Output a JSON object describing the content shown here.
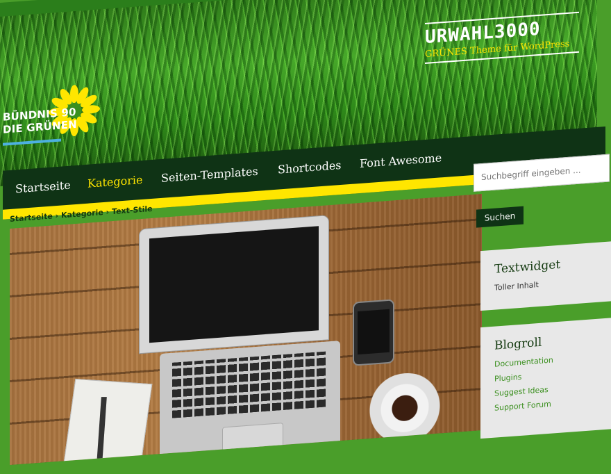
{
  "header": {
    "logo_line1": "BÜNDNIS 90",
    "logo_line2": "DIE GRÜNEN",
    "site_title": "URWAHL3000",
    "site_subtitle": "GRÜNES Theme für WordPress"
  },
  "nav": {
    "items": [
      {
        "label": "Startseite",
        "active": false
      },
      {
        "label": "Kategorie",
        "active": true
      },
      {
        "label": "Seiten-Templates",
        "active": false
      },
      {
        "label": "Shortcodes",
        "active": false
      },
      {
        "label": "Font Awesome",
        "active": false
      }
    ]
  },
  "breadcrumb": {
    "items": [
      "Startseite",
      "Kategorie",
      "Text-Stile"
    ],
    "separator": "›"
  },
  "sidebar": {
    "search_placeholder": "Suchbegriff eingeben ...",
    "search_button": "Suchen",
    "text_widget": {
      "title": "Textwidget",
      "body": "Toller Inhalt"
    },
    "blogroll": {
      "title": "Blogroll",
      "links": [
        "Documentation",
        "Plugins",
        "Suggest Ideas",
        "Support Forum"
      ]
    }
  },
  "colors": {
    "page_green": "#4a9e2a",
    "nav_dark": "#0f3315",
    "accent_yellow": "#ffe600",
    "link_green": "#3a8f1e"
  },
  "icons": [
    "sunflower-logo-icon"
  ]
}
